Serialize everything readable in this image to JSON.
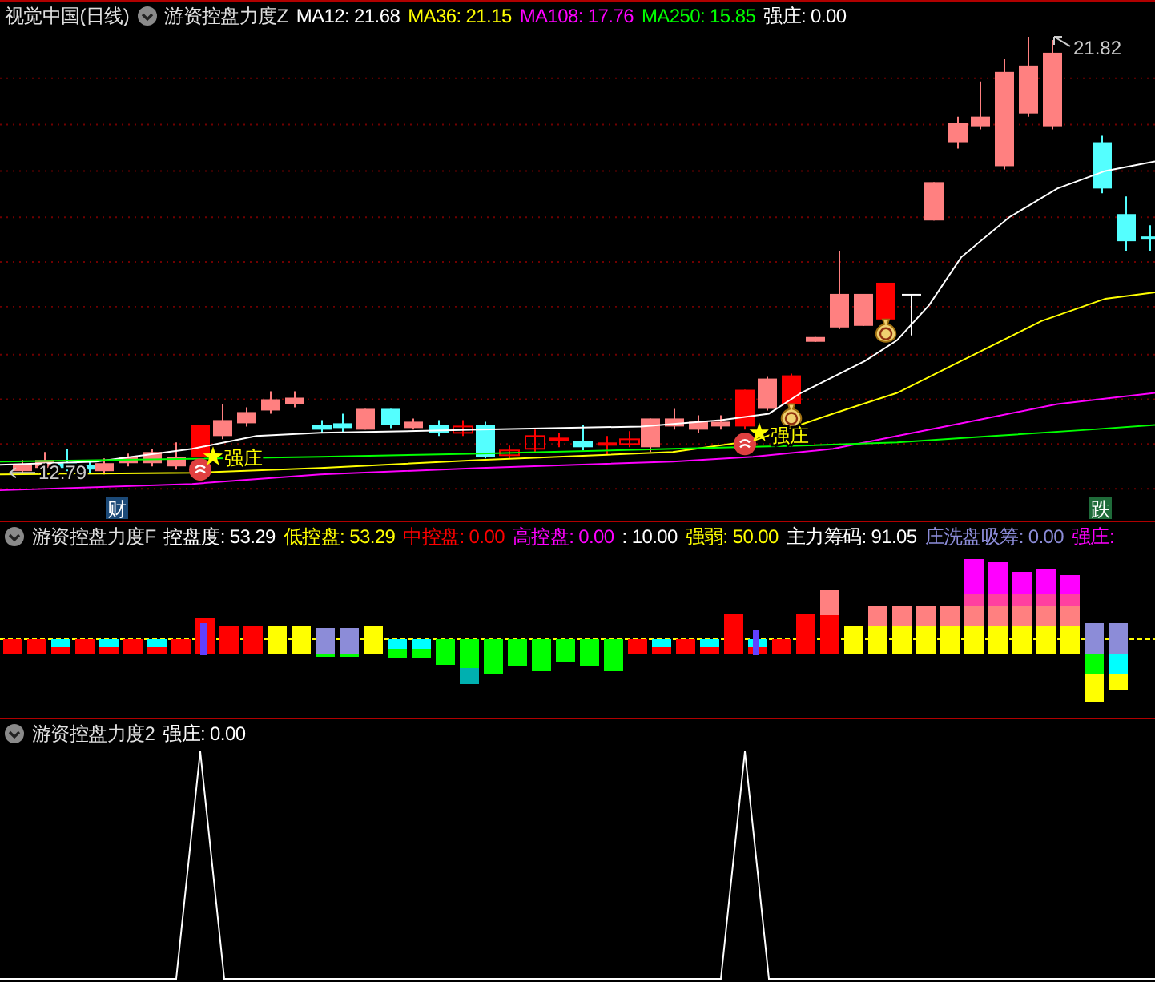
{
  "main_panel": {
    "title": "视觉中国(日线)",
    "indicator": "游资控盘力度Z",
    "readings": [
      {
        "text": "MA12: 21.68",
        "color": "#ffffff"
      },
      {
        "text": "MA36: 21.15",
        "color": "#ffff00"
      },
      {
        "text": "MA108: 17.76",
        "color": "#ff00ff"
      },
      {
        "text": "MA250: 15.85",
        "color": "#00ff00"
      },
      {
        "text": "强庄: 0.00",
        "color": "#ffffff"
      }
    ],
    "high_label": "21.82",
    "low_label": "12.79",
    "signals": [
      "强庄",
      "强庄"
    ],
    "markers": [
      {
        "text": "财",
        "color": "#1c4a78"
      },
      {
        "text": "跌",
        "color": "#1f6b3a"
      }
    ]
  },
  "control_panel": {
    "indicator": "游资控盘力度F",
    "readings": [
      {
        "text": "控盘度: 53.29",
        "color": "#ffffff"
      },
      {
        "text": "低控盘: 53.29",
        "color": "#ffff00"
      },
      {
        "text": "中控盘: 0.00",
        "color": "#ff0000"
      },
      {
        "text": "高控盘: 0.00",
        "color": "#ff00ff"
      },
      {
        "text": ": 10.00",
        "color": "#ffffff"
      },
      {
        "text": "强弱: 50.00",
        "color": "#ffff00"
      },
      {
        "text": "主力筹码: 91.05",
        "color": "#ffffff"
      },
      {
        "text": "庄洗盘吸筹: 0.00",
        "color": "#8c8cd8"
      },
      {
        "text": "强庄:",
        "color": "#ff00ff"
      }
    ]
  },
  "strength_panel": {
    "indicator": "游资控盘力度2",
    "readings": [
      {
        "text": "强庄: 0.00",
        "color": "#ffffff"
      }
    ]
  }
}
